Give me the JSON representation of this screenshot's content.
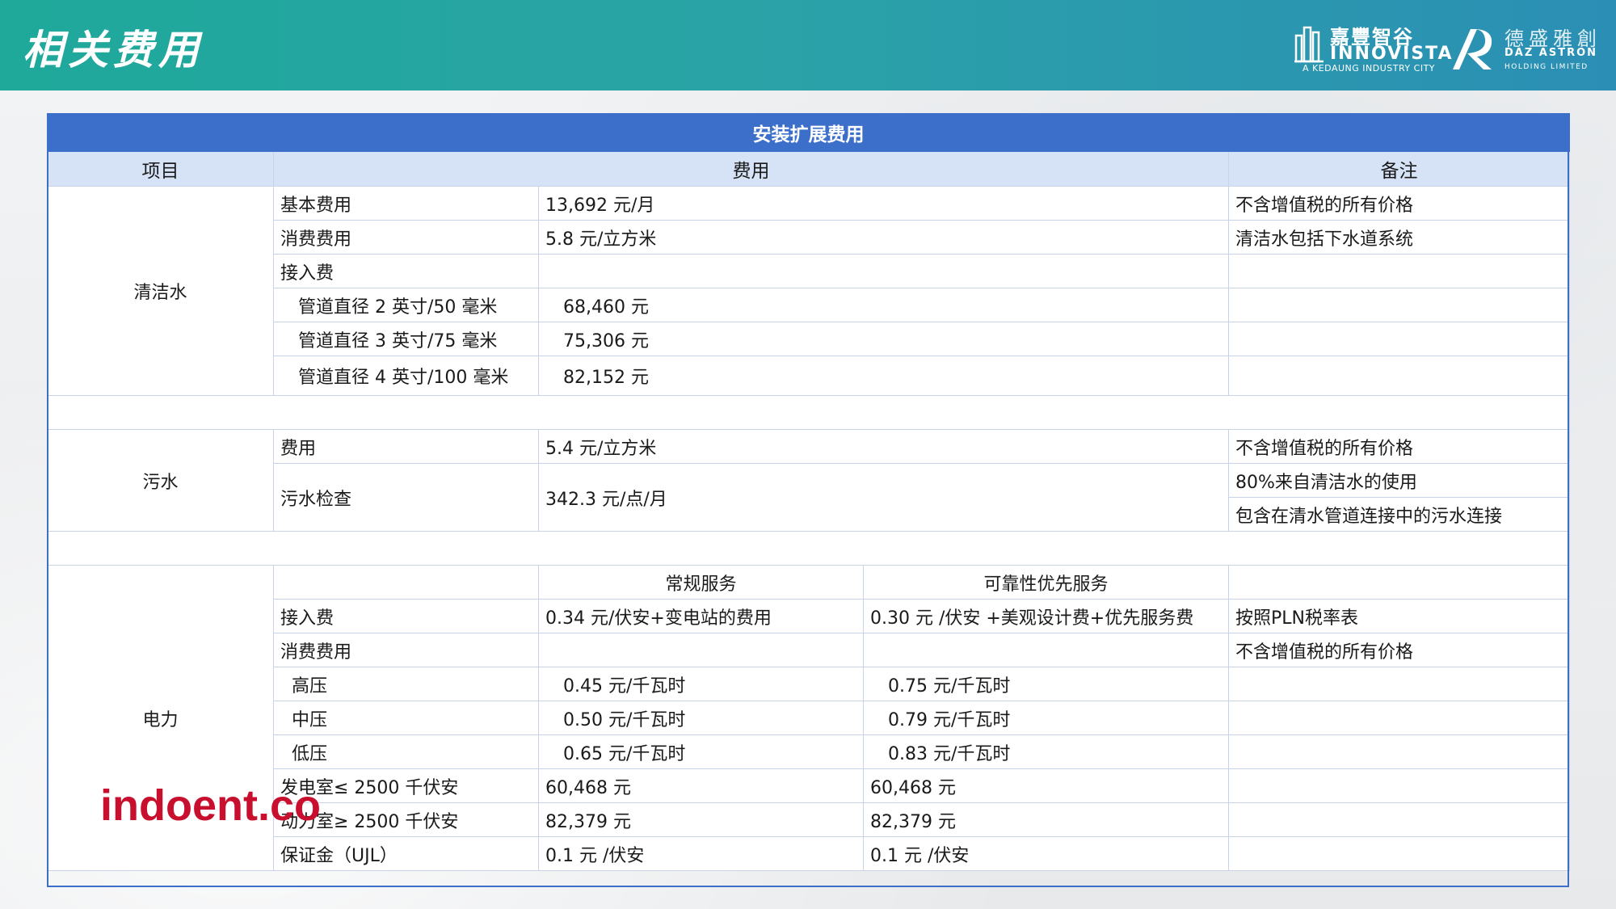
{
  "header": {
    "title": "相关费用",
    "logo1": {
      "cn": "嘉豐智谷",
      "en": "INNOVISTA",
      "tag": "A KEDAUNG INDUSTRY CITY"
    },
    "logo2": {
      "cn": "德盛雅創",
      "en": "DAZ ASTRON",
      "sub": "HOLDING LIMITED"
    }
  },
  "table": {
    "caption": "安装扩展费用",
    "headers": {
      "item": "项目",
      "fee": "费用",
      "note": "备注"
    },
    "water": {
      "category": "清洁水",
      "rows": [
        {
          "label": "基本费用",
          "value": "13,692 元/月",
          "note": "不含增值税的所有价格"
        },
        {
          "label": "消费费用",
          "value": "5.8 元/立方米",
          "note": "清洁水包括下水道系统"
        },
        {
          "label": "接入费",
          "value": "",
          "note": ""
        },
        {
          "label": "管道直径 2 英寸/50 毫米",
          "value": "68,460 元",
          "note": ""
        },
        {
          "label": "管道直径 3 英寸/75 毫米",
          "value": "75,306 元",
          "note": ""
        },
        {
          "label": "管道直径 4 英寸/100 毫米",
          "value": "82,152 元",
          "note": ""
        }
      ]
    },
    "sewage": {
      "category": "污水",
      "rows": [
        {
          "label": "费用",
          "value": "5.4 元/立方米",
          "note": "不含增值税的所有价格"
        },
        {
          "label": "污水检查",
          "value": "342.3 元/点/月",
          "note1": "80%来自清洁水的使用",
          "note2": "包含在清水管道连接中的污水连接"
        }
      ]
    },
    "power": {
      "category": "电力",
      "subheaders": {
        "regular": "常规服务",
        "priority": "可靠性优先服务"
      },
      "rows": [
        {
          "label": "接入费",
          "regular": "0.34 元/伏安+变电站的费用",
          "priority": "0.30 元 /伏安 +美观设计费+优先服务费",
          "note": "按照PLN税率表"
        },
        {
          "label": "消费费用",
          "regular": "",
          "priority": "",
          "note": "不含增值税的所有价格"
        },
        {
          "label": "高压",
          "regular": "0.45 元/千瓦时",
          "priority": "0.75 元/千瓦时",
          "note": ""
        },
        {
          "label": "中压",
          "regular": "0.50 元/千瓦时",
          "priority": "0.79 元/千瓦时",
          "note": ""
        },
        {
          "label": "低压",
          "regular": "0.65 元/千瓦时",
          "priority": "0.83 元/千瓦时",
          "note": ""
        },
        {
          "label": "发电室≤ 2500 千伏安",
          "regular": "60,468 元",
          "priority": "60,468 元",
          "note": ""
        },
        {
          "label": "动力室≥ 2500 千伏安",
          "regular": "82,379 元",
          "priority": "82,379 元",
          "note": ""
        },
        {
          "label": "保证金（UJL）",
          "regular": "0.1 元 /伏安",
          "priority": "0.1 元 /伏安",
          "note": ""
        }
      ]
    }
  },
  "watermark": "indoent.co"
}
